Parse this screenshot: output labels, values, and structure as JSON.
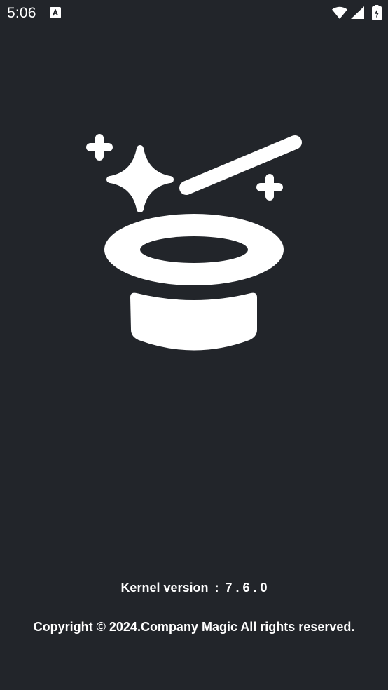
{
  "status_bar": {
    "time": "5:06",
    "notification_icon": "font-a-icon",
    "wifi_icon": "wifi-icon",
    "signal_icon": "cell-signal-icon",
    "battery_icon": "battery-charging-icon"
  },
  "logo": {
    "icon": "magic-hat-wand-icon",
    "color": "#ffffff"
  },
  "kernel": {
    "label": "Kernel version",
    "separator": ":",
    "value": "7.6.0"
  },
  "copyright": "Copyright © 2024.Company Magic All rights reserved.",
  "theme": {
    "background": "#22252a",
    "foreground": "#ffffff"
  }
}
